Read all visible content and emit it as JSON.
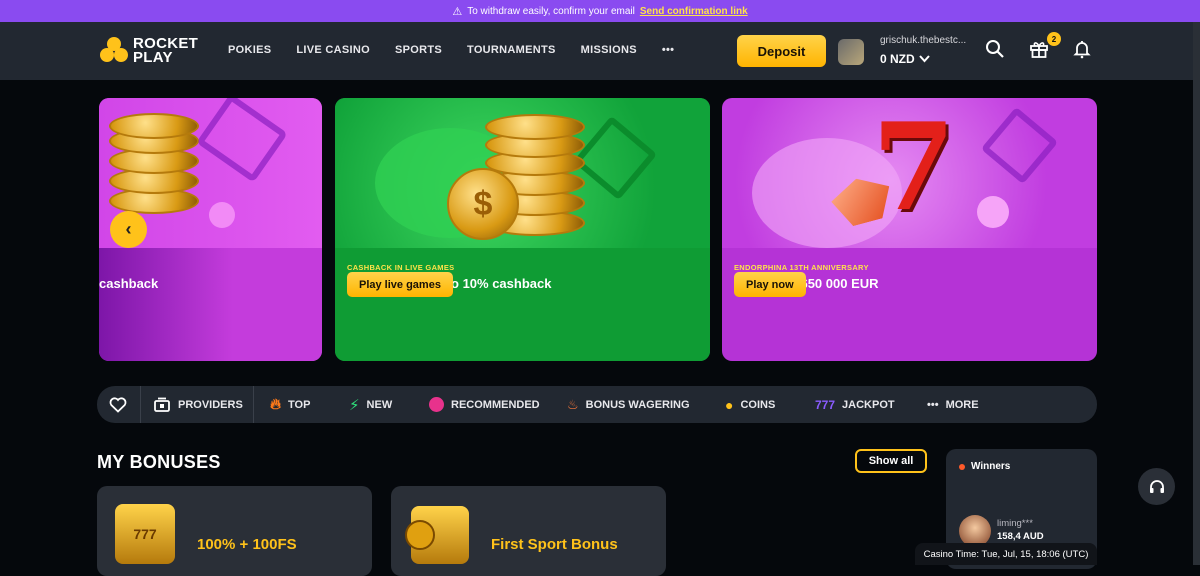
{
  "notice": {
    "text": "To withdraw easily, confirm your email",
    "link": "Send confirmation link"
  },
  "logo": {
    "line1": "ROCKET",
    "line2": "PLAY"
  },
  "nav": {
    "items": [
      "POKIES",
      "LIVE CASINO",
      "SPORTS",
      "TOURNAMENTS",
      "MISSIONS",
      "•••"
    ]
  },
  "header": {
    "deposit_label": "Deposit",
    "username": "grischuk.thebestc...",
    "balance": "0 NZD",
    "gift_count": "2"
  },
  "banners": [
    {
      "tag": "",
      "title": "cashback",
      "button": ""
    },
    {
      "tag": "CASHBACK IN LIVE GAMES",
      "title": "Play and get up to 10% cashback",
      "button": "Play live games"
    },
    {
      "tag": "ENDORPHINA 13TH ANNIVERSARY",
      "title": "Prize Pool 650 000 EUR",
      "button": "Play now"
    }
  ],
  "categories": [
    "PROVIDERS",
    "TOP",
    "NEW",
    "RECOMMENDED",
    "BONUS WAGERING",
    "COINS",
    "JACKPOT",
    "MORE"
  ],
  "bonuses": {
    "title": "MY BONUSES",
    "show_all": "Show all",
    "cards": [
      "100% + 100FS",
      "First Sport Bonus"
    ]
  },
  "winners": {
    "title": "Winners",
    "user": "liming***",
    "amount": "158,4 AUD"
  },
  "casino_time": "Casino Time: Tue, Jul, 15, 18:06 (UTC)",
  "colors": {
    "accent": "#ffc21a",
    "notice_bg": "#8a4bf0",
    "header_bg": "#222831",
    "page_bg": "#05080c"
  }
}
